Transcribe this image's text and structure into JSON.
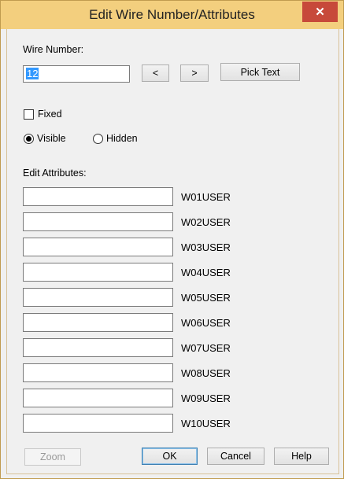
{
  "window": {
    "title": "Edit Wire Number/Attributes",
    "close_glyph": "✕"
  },
  "wire": {
    "label": "Wire Number:",
    "value": "12",
    "prev_label": "<",
    "next_label": ">",
    "pick_text_label": "Pick Text"
  },
  "options": {
    "fixed_label": "Fixed",
    "fixed_checked": false,
    "visible_label": "Visible",
    "hidden_label": "Hidden",
    "visibility_selected": "Visible"
  },
  "attributes": {
    "label": "Edit Attributes:",
    "rows": [
      {
        "name": "W01USER",
        "value": ""
      },
      {
        "name": "W02USER",
        "value": ""
      },
      {
        "name": "W03USER",
        "value": ""
      },
      {
        "name": "W04USER",
        "value": ""
      },
      {
        "name": "W05USER",
        "value": ""
      },
      {
        "name": "W06USER",
        "value": ""
      },
      {
        "name": "W07USER",
        "value": ""
      },
      {
        "name": "W08USER",
        "value": ""
      },
      {
        "name": "W09USER",
        "value": ""
      },
      {
        "name": "W10USER",
        "value": ""
      }
    ]
  },
  "footer": {
    "zoom_label": "Zoom",
    "zoom_enabled": false,
    "ok_label": "OK",
    "cancel_label": "Cancel",
    "help_label": "Help"
  },
  "colors": {
    "titlebar": "#f3cf7e",
    "close_button": "#c7493a",
    "selection": "#3399ff"
  }
}
